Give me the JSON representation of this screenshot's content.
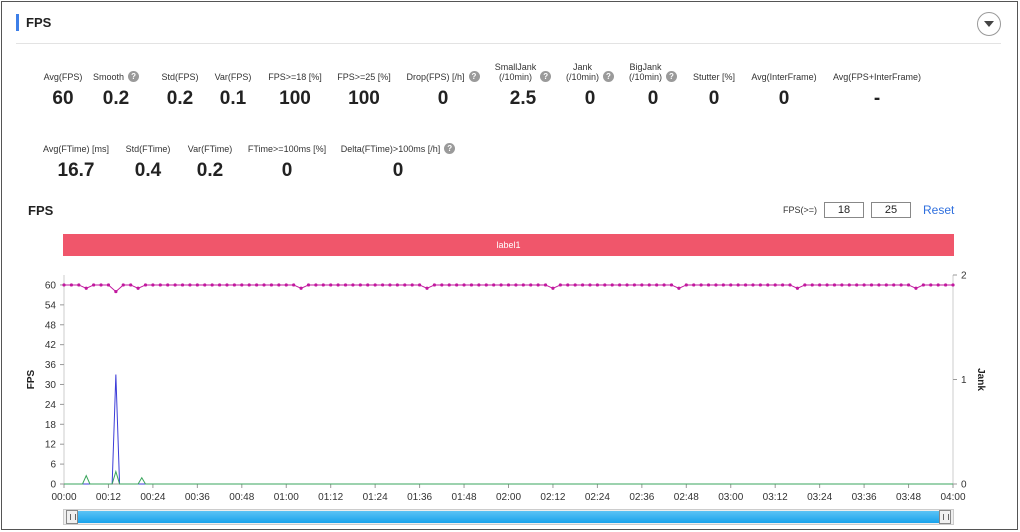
{
  "header": {
    "title": "FPS",
    "collapse_icon": "chevron-down-icon"
  },
  "stats_row1": [
    {
      "label": "Avg(FPS)",
      "value": "60",
      "help": false
    },
    {
      "label": "Smooth",
      "value": "0.2",
      "help": true
    },
    {
      "label": "Std(FPS)",
      "value": "0.2",
      "help": false
    },
    {
      "label": "Var(FPS)",
      "value": "0.1",
      "help": false
    },
    {
      "label": "FPS>=18 [%]",
      "value": "100",
      "help": false
    },
    {
      "label": "FPS>=25 [%]",
      "value": "100",
      "help": false
    },
    {
      "label": "Drop(FPS) [/h]",
      "value": "0",
      "help": true
    },
    {
      "label": "SmallJank\n(/10min)",
      "value": "2.5",
      "help": true
    },
    {
      "label": "Jank\n(/10min)",
      "value": "0",
      "help": true
    },
    {
      "label": "BigJank\n(/10min)",
      "value": "0",
      "help": true
    },
    {
      "label": "Stutter [%]",
      "value": "0",
      "help": false
    },
    {
      "label": "Avg(InterFrame)",
      "value": "0",
      "help": false
    },
    {
      "label": "Avg(FPS+InterFrame)",
      "value": "-",
      "help": false
    }
  ],
  "stats_row2": [
    {
      "label": "Avg(FTime) [ms]",
      "value": "16.7",
      "help": false
    },
    {
      "label": "Std(FTime)",
      "value": "0.4",
      "help": false
    },
    {
      "label": "Var(FTime)",
      "value": "0.2",
      "help": false
    },
    {
      "label": "FTime>=100ms [%]",
      "value": "0",
      "help": false
    },
    {
      "label": "Delta(FTime)>100ms [/h]",
      "value": "0",
      "help": true
    }
  ],
  "chart_section": {
    "title": "FPS",
    "threshold_label": "FPS(>=)",
    "threshold_low": "18",
    "threshold_high": "25",
    "reset_label": "Reset",
    "label_bar_text": "label1",
    "label_bar_color": "#f0566b"
  },
  "chart_data": {
    "type": "line",
    "ylabel": "FPS",
    "y2label": "Jank",
    "ylim": [
      0,
      63
    ],
    "y2lim": [
      0,
      2
    ],
    "yticks": [
      "0",
      "6",
      "12",
      "18",
      "24",
      "30",
      "36",
      "42",
      "48",
      "54",
      "60"
    ],
    "y2ticks": [
      "0",
      "1",
      "2"
    ],
    "xticks": [
      "00:00",
      "00:12",
      "00:24",
      "00:36",
      "00:48",
      "01:00",
      "01:12",
      "01:24",
      "01:36",
      "01:48",
      "02:00",
      "02:12",
      "02:24",
      "02:36",
      "02:48",
      "03:00",
      "03:12",
      "03:24",
      "03:36",
      "03:48",
      "04:00"
    ],
    "x_range_seconds": [
      0,
      240
    ],
    "grid": false,
    "series": [
      {
        "color": "#c1189e",
        "axis": "left",
        "baseline": 60,
        "dips": [
          [
            6,
            59
          ],
          [
            14,
            58
          ],
          [
            20,
            59
          ],
          [
            31,
            59
          ],
          [
            64,
            59
          ],
          [
            98,
            59
          ],
          [
            132,
            59
          ],
          [
            166,
            59
          ],
          [
            198,
            59
          ],
          [
            230,
            59
          ]
        ]
      },
      {
        "color": "#3c3cd8",
        "axis": "left",
        "points": [
          [
            0,
            0
          ],
          [
            13,
            0
          ],
          [
            14,
            33
          ],
          [
            15,
            0
          ],
          [
            240,
            0
          ]
        ]
      },
      {
        "color": "#3aa55c",
        "axis": "right",
        "points": [
          [
            0,
            0
          ],
          [
            5,
            0
          ],
          [
            6,
            0.08
          ],
          [
            7,
            0
          ],
          [
            13,
            0
          ],
          [
            14,
            0.12
          ],
          [
            15,
            0
          ],
          [
            20,
            0
          ],
          [
            21,
            0.06
          ],
          [
            22,
            0
          ],
          [
            240,
            0
          ]
        ]
      }
    ]
  }
}
